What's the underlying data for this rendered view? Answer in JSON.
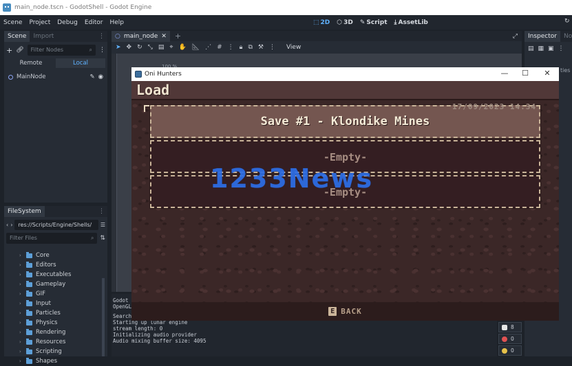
{
  "window": {
    "title": "main_node.tscn - GodotShell - Godot Engine"
  },
  "menu": [
    "Scene",
    "Project",
    "Debug",
    "Editor",
    "Help"
  ],
  "workspaces": [
    {
      "label": "2D",
      "active": true
    },
    {
      "label": "3D",
      "active": false
    },
    {
      "label": "Script",
      "active": false
    },
    {
      "label": "AssetLib",
      "active": false
    }
  ],
  "scene_panel": {
    "tabs": [
      "Scene",
      "Import"
    ],
    "filter_placeholder": "Filter Nodes",
    "remote_label": "Remote",
    "local_label": "Local",
    "root_node": "MainNode"
  },
  "filesystem": {
    "tab": "FileSystem",
    "path": "res://Scripts/Engine/Shells/",
    "filter_placeholder": "Filter Files",
    "folders": [
      "Core",
      "Editors",
      "Executables",
      "Gameplay",
      "GIF",
      "Input",
      "Particles",
      "Physics",
      "Rendering",
      "Resources",
      "Scripting",
      "Shapes"
    ]
  },
  "editor": {
    "scene_tab": "main_node",
    "view_label": "View",
    "zoom": "100 %"
  },
  "inspector": {
    "tabs": [
      "Inspector",
      "Node"
    ],
    "partial_label": "ties"
  },
  "console": {
    "partial_lines": [
      "Godot E",
      "OpenGL"
    ],
    "lines": [
      "Search:",
      "Starting up lunar engine",
      "stream length: 0",
      "Initializing audio provider",
      "Audio mixing buffer size: 4095"
    ]
  },
  "debug_counters": {
    "warnings": "8",
    "errors": "0",
    "infos": "0"
  },
  "game": {
    "window_title": "Oni Hunters",
    "screen_title": "Load",
    "slots": [
      {
        "name": "Save #1 - Klondike Mines",
        "date": "17/09/2023  14:34",
        "selected": true
      },
      {
        "name": "-Empty-",
        "date": "",
        "selected": false
      },
      {
        "name": "-Empty-",
        "date": "",
        "selected": false
      }
    ],
    "back_key": "E",
    "back_label": "BACK"
  },
  "watermark": "1233News",
  "colors": {
    "accent": "#5fb2ff",
    "editor_bg": "#1d2229",
    "game_bg": "#3b2727",
    "slot_selected": "#745650",
    "watermark": "#2d6fe8"
  }
}
